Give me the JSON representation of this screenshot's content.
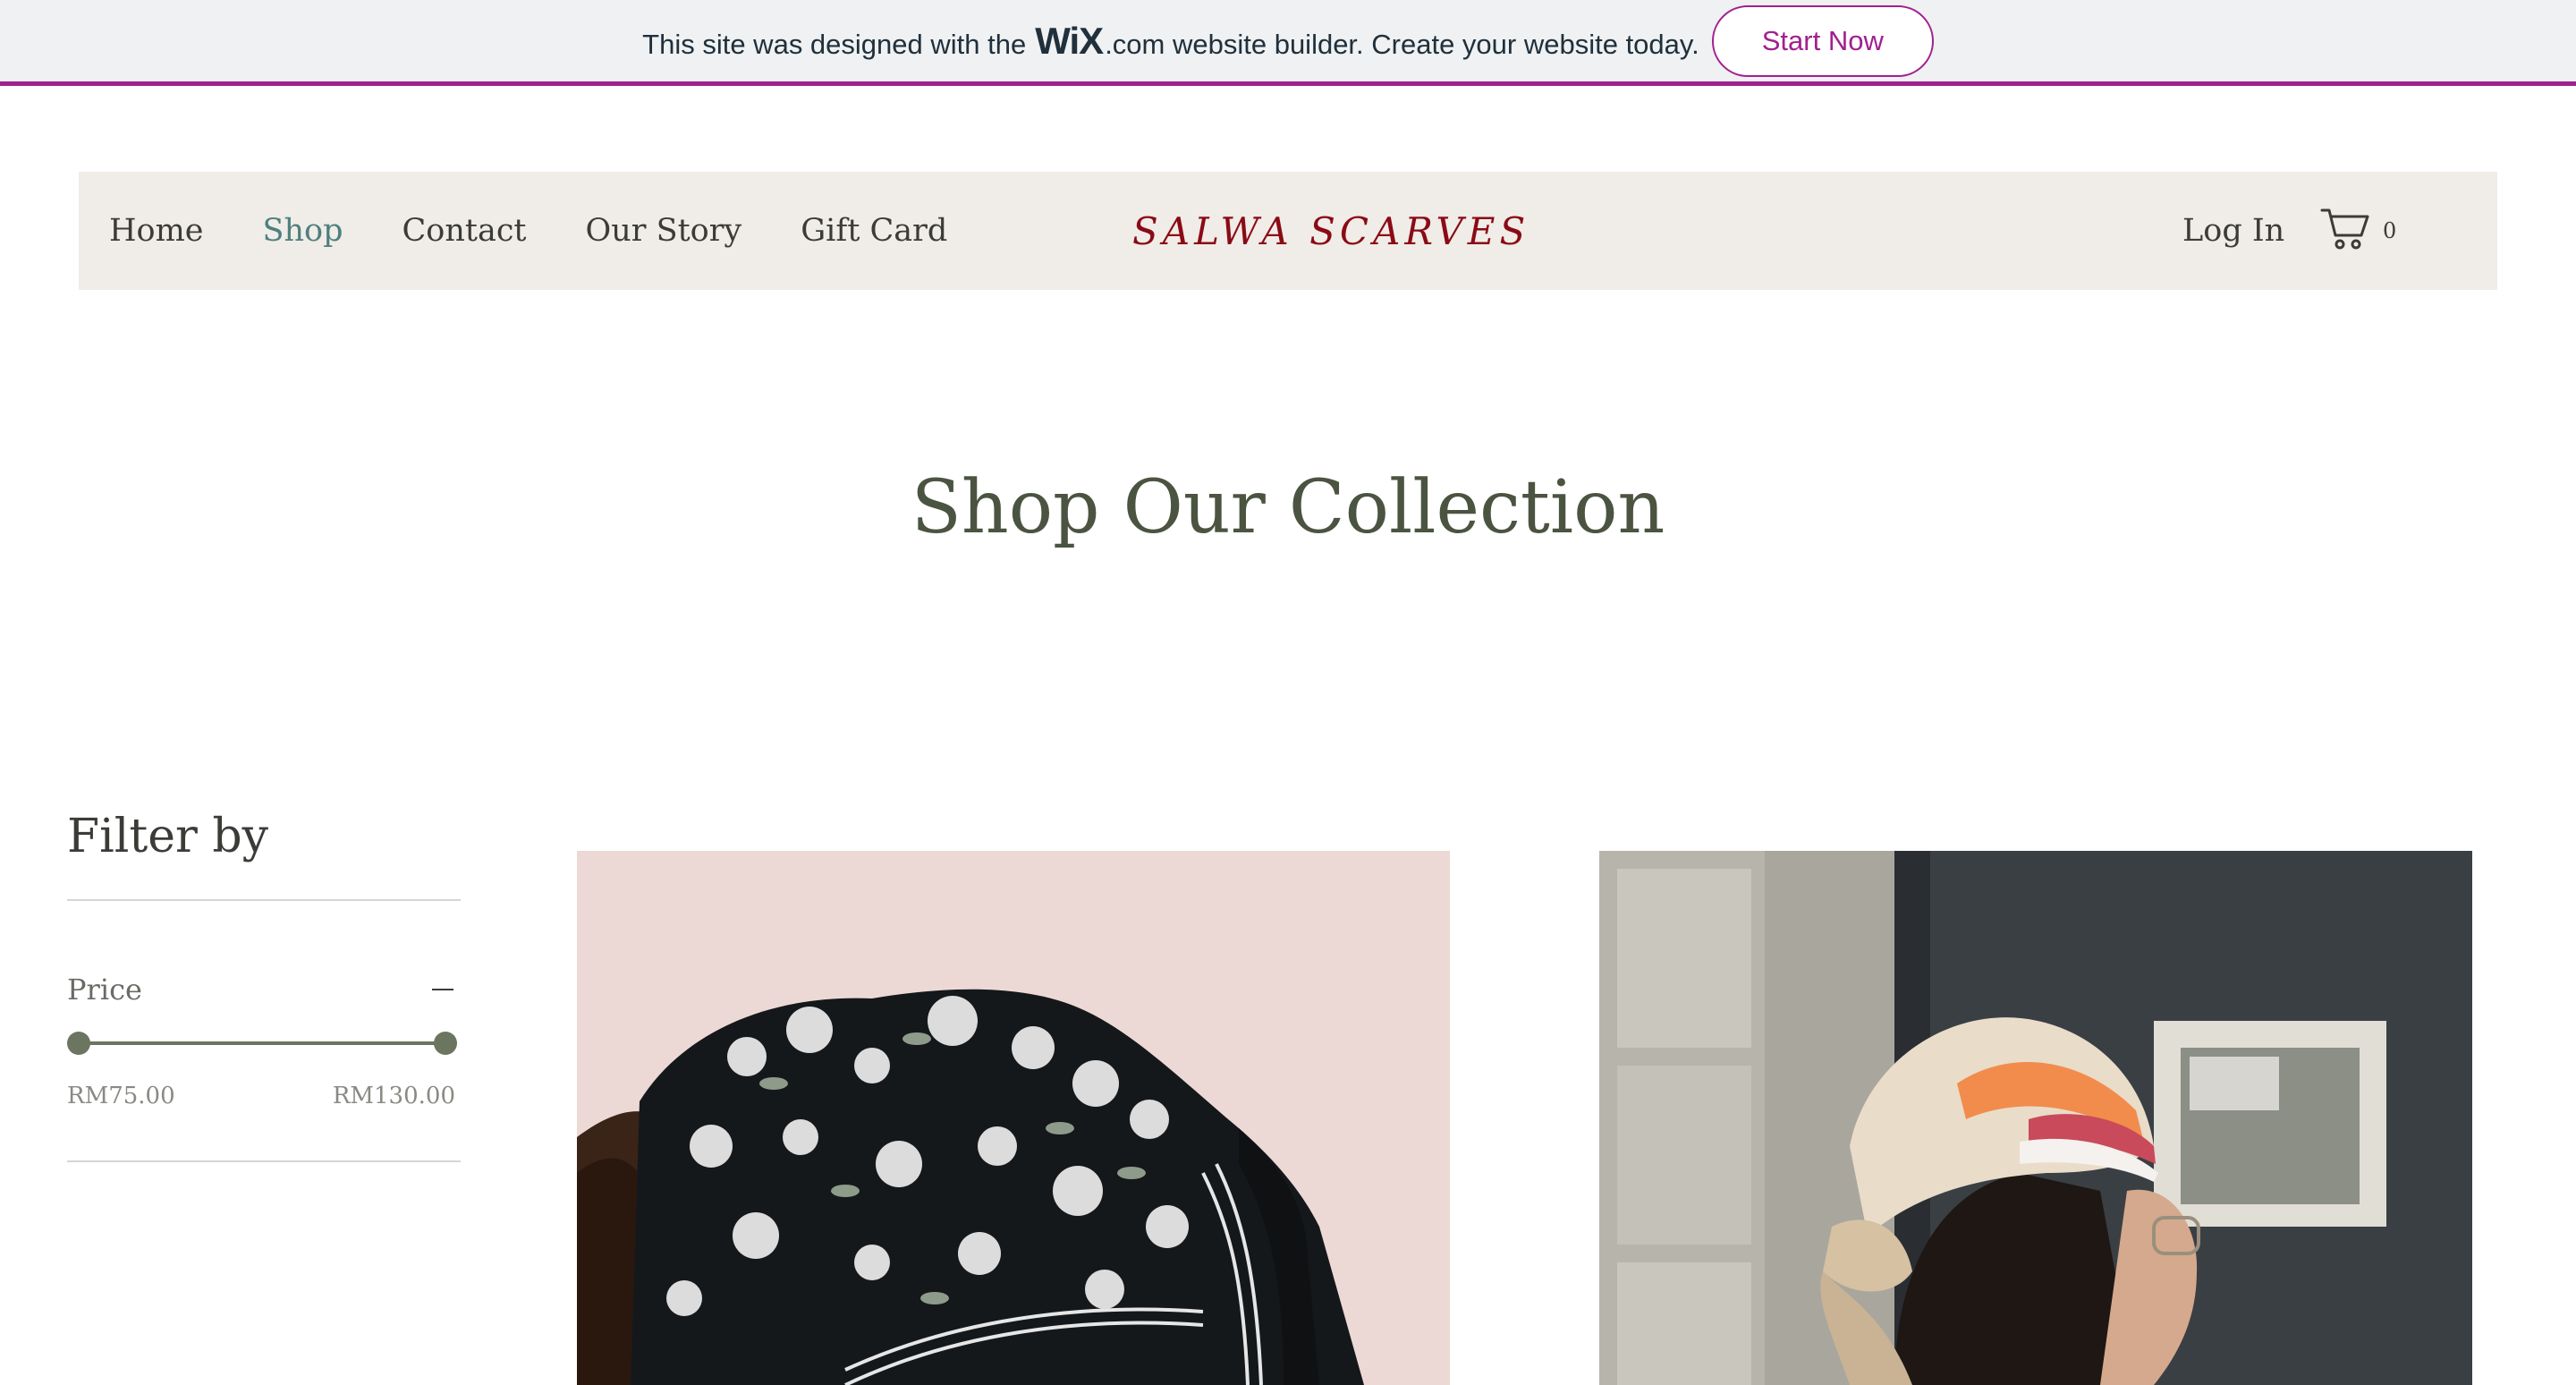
{
  "banner": {
    "text_before": "This site was designed with the",
    "wix_logo": "WiX",
    "text_after": ".com website builder. Create your website today.",
    "cta_label": "Start Now",
    "accent_color": "#a1208f"
  },
  "header": {
    "nav": [
      {
        "label": "Home",
        "active": false
      },
      {
        "label": "Shop",
        "active": true
      },
      {
        "label": "Contact",
        "active": false
      },
      {
        "label": "Our Story",
        "active": false
      },
      {
        "label": "Gift Card",
        "active": false
      }
    ],
    "logo": "SALWA SCARVES",
    "login_label": "Log In",
    "cart_icon": "cart-icon",
    "cart_count": "0",
    "background_color": "#f0ece7"
  },
  "page": {
    "title": "Shop Our Collection"
  },
  "filter": {
    "title": "Filter by",
    "price_label": "Price",
    "collapse_icon": "minus-icon",
    "price_min": "RM75.00",
    "price_max": "RM130.00",
    "slider_low_fraction": 0,
    "slider_high_fraction": 1
  },
  "products": [
    {
      "image": "black-floral-scarf-photo"
    },
    {
      "image": "silk-headscarf-photo"
    }
  ]
}
